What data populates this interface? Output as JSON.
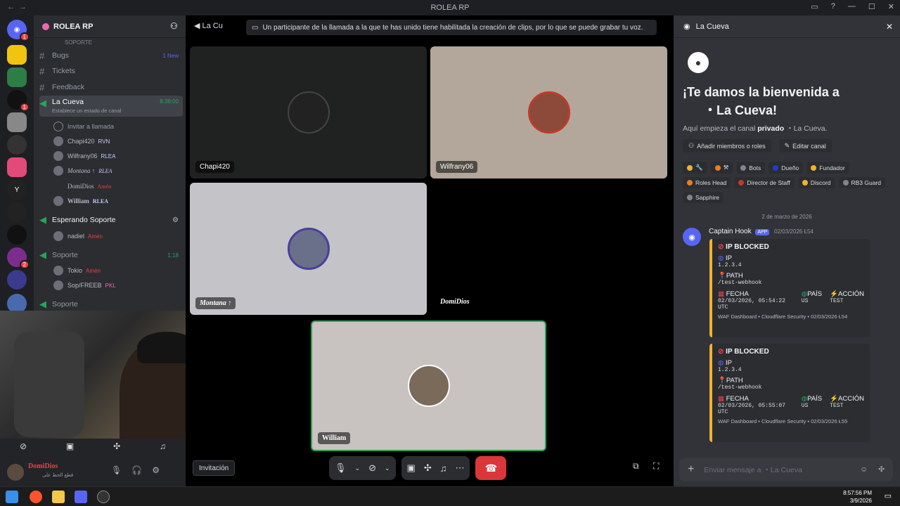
{
  "window": {
    "title": "ROLEA RP"
  },
  "server": {
    "name": "ROLEA RP"
  },
  "channels": {
    "section_label": "SOPORTE",
    "items": [
      {
        "label": "Bugs",
        "badge": "1 New"
      },
      {
        "label": "Tickets"
      },
      {
        "label": "Feedback"
      },
      {
        "label": "La Cueva",
        "time": "8:38:00",
        "status": "Establece un estado de canal"
      },
      {
        "label": "Invitar a llamada"
      }
    ],
    "members": [
      {
        "name": "Chapi420",
        "tag": "RVN"
      },
      {
        "name": "Wilfrany06",
        "tag": "RLEA"
      },
      {
        "name": "Montana ↑",
        "tag": "RLEA"
      },
      {
        "name": "DomiDios",
        "tag": "Amén"
      },
      {
        "name": "William",
        "tag": "RLEA"
      }
    ],
    "waiting": {
      "label": "Esperando Soporte",
      "member": "nadiel",
      "member_tag": "Amén"
    },
    "soporte1": {
      "label": "Soporte",
      "time": "1:18",
      "m1": "Tokio",
      "m1_tag": "Amén",
      "m2": "Sop/FREEB",
      "m2_tag": "PKL"
    },
    "soporte2": {
      "label": "Soporte"
    }
  },
  "user": {
    "name": "DomiDios",
    "status": "قطع الخط على"
  },
  "call": {
    "title": "La Cu",
    "notice": "Un participante de la llamada a la que te has unido tiene habilitada la creación de clips, por lo que se puede grabar tu voz.",
    "tiles": {
      "chapi": "Chapi420",
      "wilfrany": "Wilfrany06",
      "montana": "Montana ↑",
      "domidios": "DomiDios",
      "william": "William"
    },
    "invite": "Invitación"
  },
  "panel": {
    "header": "La Cueva",
    "welcome": "¡Te damos la bienvenida a",
    "welcome2": "・La Cueva!",
    "sub_pre": "Aquí empieza el canal ",
    "sub_bold": "privado",
    "sub_post": " ・La Cueva.",
    "add_members": "Añadir miembros o roles",
    "edit_channel": "Editar canal",
    "roles": [
      "Bots",
      "Dueño",
      "Fundador",
      "Roles Head",
      "Director de Staff",
      "Discord",
      "RB3 Guard",
      "Sapphire"
    ],
    "date_divider": "2 de marzo de 2026",
    "bot_name": "Captain Hook",
    "bot_tag": "APP",
    "bot_time": "02/03/2026 Ł54",
    "msg_placeholder": "Enviar mensaje a ・La Cueva"
  },
  "embeds": [
    {
      "title": "IP BLOCKED",
      "ip_label": "IP",
      "ip": "1.2.3.4",
      "path_label": "PATH",
      "path": "/test-webhook",
      "fecha_label": "FECHA",
      "fecha": "02/03/2026, 05:54:22 UTC",
      "pais_label": "PAÍS",
      "pais": "US",
      "accion_label": "ACCIÓN",
      "accion": "TEST",
      "footer": "WAF Dashboard • Cloudflare Security • 02/03/2026 Ł54"
    },
    {
      "title": "IP BLOCKED",
      "ip_label": "IP",
      "ip": "1.2.3.4",
      "path_label": "PATH",
      "path": "/test-webhook",
      "fecha_label": "FECHA",
      "fecha": "02/03/2026, 05:55:07 UTC",
      "pais_label": "PAÍS",
      "pais": "US",
      "accion_label": "ACCIÓN",
      "accion": "TEST",
      "footer": "WAF Dashboard • Cloudflare Security • 02/03/2026 Ł55"
    }
  ],
  "taskbar": {
    "time": "8:57:56 PM",
    "date": "3/9/2026"
  },
  "colors": {
    "accent": "#5865f2",
    "danger": "#da373c",
    "embed": "#f0b232",
    "active_green": "#23a55a"
  }
}
